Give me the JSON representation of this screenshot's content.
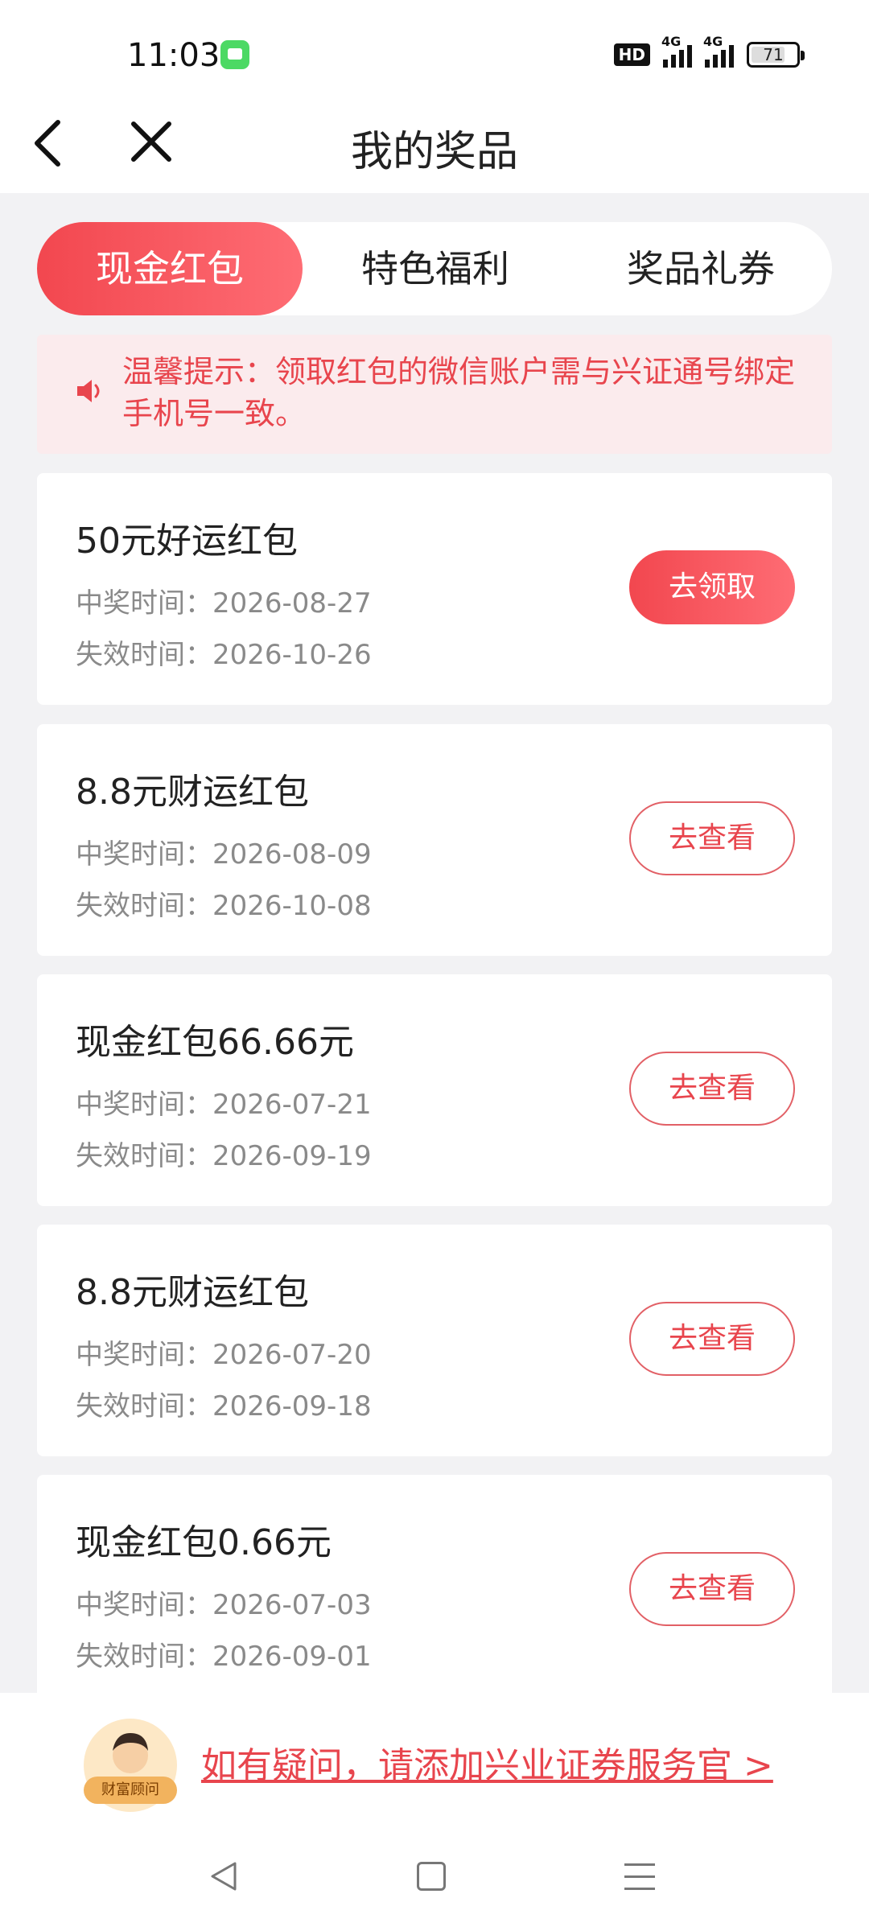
{
  "status_bar": {
    "time": "11:03",
    "network_1": "4G",
    "network_2": "4G",
    "hd_label": "HD",
    "battery": "71"
  },
  "header": {
    "title": "我的奖品",
    "back_icon": "chevron-left-icon",
    "close_icon": "close-icon"
  },
  "tabs": [
    {
      "label": "现金红包",
      "active": true
    },
    {
      "label": "特色福利",
      "active": false
    },
    {
      "label": "奖品礼券",
      "active": false
    }
  ],
  "notice": {
    "icon": "speaker-icon",
    "text": "温馨提示：领取红包的微信账户需与兴证通号绑定手机号一致。"
  },
  "prizes": [
    {
      "name": "50元好运红包",
      "win_time": "中奖时间：2026-08-27",
      "expire_time": "失效时间：2026-10-26",
      "button": "去领取",
      "style": "primary"
    },
    {
      "name": "8.8元财运红包",
      "win_time": "中奖时间：2026-08-09",
      "expire_time": "失效时间：2026-10-08",
      "button": "去查看",
      "style": "outline"
    },
    {
      "name": "现金红包66.66元",
      "win_time": "中奖时间：2026-07-21",
      "expire_time": "失效时间：2026-09-19",
      "button": "去查看",
      "style": "outline"
    },
    {
      "name": "8.8元财运红包",
      "win_time": "中奖时间：2026-07-20",
      "expire_time": "失效时间：2026-09-18",
      "button": "去查看",
      "style": "outline"
    },
    {
      "name": "现金红包0.66元",
      "win_time": "中奖时间：2026-07-03",
      "expire_time": "失效时间：2026-09-01",
      "button": "去查看",
      "style": "outline"
    }
  ],
  "footer": {
    "advisor_badge": "财富顾问",
    "help_link": "如有疑问，请添加兴业证券服务官 >"
  },
  "colors": {
    "accent": "#f2474f",
    "notice_bg": "#fbebed",
    "page_bg": "#f2f2f4"
  }
}
